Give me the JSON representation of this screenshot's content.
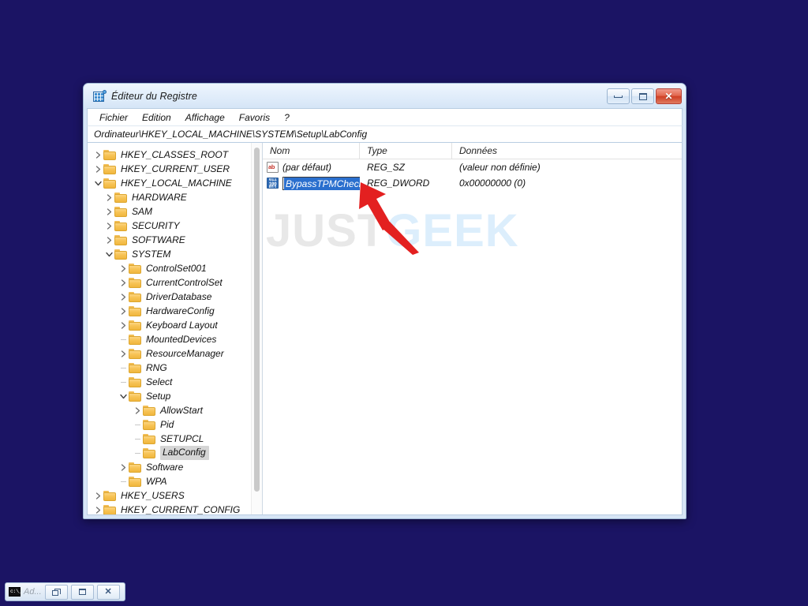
{
  "window": {
    "title": "Éditeur du Registre",
    "title_icon": "registry-editor-icon",
    "controls": {
      "minimize": "minimize-icon",
      "maximize": "restore-icon",
      "close": "close-icon"
    }
  },
  "menubar": {
    "items": [
      {
        "label": "Fichier"
      },
      {
        "label": "Edition"
      },
      {
        "label": "Affichage"
      },
      {
        "label": "Favoris"
      },
      {
        "label": "?"
      }
    ]
  },
  "address": {
    "path": "Ordinateur\\HKEY_LOCAL_MACHINE\\SYSTEM\\Setup\\LabConfig"
  },
  "tree": {
    "nodes": [
      {
        "label": "HKEY_CLASSES_ROOT",
        "depth": 0,
        "state": "collapsed",
        "selected": false
      },
      {
        "label": "HKEY_CURRENT_USER",
        "depth": 0,
        "state": "collapsed",
        "selected": false
      },
      {
        "label": "HKEY_LOCAL_MACHINE",
        "depth": 0,
        "state": "expanded",
        "selected": false
      },
      {
        "label": "HARDWARE",
        "depth": 1,
        "state": "collapsed",
        "selected": false
      },
      {
        "label": "SAM",
        "depth": 1,
        "state": "collapsed",
        "selected": false
      },
      {
        "label": "SECURITY",
        "depth": 1,
        "state": "collapsed",
        "selected": false
      },
      {
        "label": "SOFTWARE",
        "depth": 1,
        "state": "collapsed",
        "selected": false
      },
      {
        "label": "SYSTEM",
        "depth": 1,
        "state": "expanded",
        "selected": false
      },
      {
        "label": "ControlSet001",
        "depth": 2,
        "state": "collapsed",
        "selected": false
      },
      {
        "label": "CurrentControlSet",
        "depth": 2,
        "state": "collapsed",
        "selected": false
      },
      {
        "label": "DriverDatabase",
        "depth": 2,
        "state": "collapsed",
        "selected": false
      },
      {
        "label": "HardwareConfig",
        "depth": 2,
        "state": "collapsed",
        "selected": false
      },
      {
        "label": "Keyboard Layout",
        "depth": 2,
        "state": "collapsed",
        "selected": false
      },
      {
        "label": "MountedDevices",
        "depth": 2,
        "state": "leaf",
        "selected": false
      },
      {
        "label": "ResourceManager",
        "depth": 2,
        "state": "collapsed",
        "selected": false
      },
      {
        "label": "RNG",
        "depth": 2,
        "state": "leaf",
        "selected": false
      },
      {
        "label": "Select",
        "depth": 2,
        "state": "leaf",
        "selected": false
      },
      {
        "label": "Setup",
        "depth": 2,
        "state": "expanded",
        "selected": false
      },
      {
        "label": "AllowStart",
        "depth": 3,
        "state": "collapsed",
        "selected": false
      },
      {
        "label": "Pid",
        "depth": 3,
        "state": "leaf",
        "selected": false
      },
      {
        "label": "SETUPCL",
        "depth": 3,
        "state": "leaf",
        "selected": false
      },
      {
        "label": "LabConfig",
        "depth": 3,
        "state": "leaf",
        "selected": true
      },
      {
        "label": "Software",
        "depth": 2,
        "state": "collapsed",
        "selected": false
      },
      {
        "label": "WPA",
        "depth": 2,
        "state": "leaf",
        "selected": false
      },
      {
        "label": "HKEY_USERS",
        "depth": 0,
        "state": "collapsed",
        "selected": false
      },
      {
        "label": "HKEY_CURRENT_CONFIG",
        "depth": 0,
        "state": "collapsed",
        "selected": false
      }
    ]
  },
  "values": {
    "columns": [
      "Nom",
      "Type",
      "Données"
    ],
    "rows": [
      {
        "icon": "string-value-icon",
        "name": "(par défaut)",
        "type": "REG_SZ",
        "data": "(valeur non définie)",
        "editing": false
      },
      {
        "icon": "dword-value-icon",
        "name": "BypassTPMCheck",
        "type": "REG_DWORD",
        "data": "0x00000000 (0)",
        "editing": true
      }
    ]
  },
  "watermark": {
    "part1": "JUST",
    "part2": "GEEK",
    "color1": "#e8e8e8",
    "color2": "#dceefc"
  },
  "annotation": {
    "arrow": "red-arrow-pointing-to-rename-field",
    "color": "#e32020"
  },
  "taskbar": {
    "app_icon": "command-prompt-icon",
    "app_label": "Ad...",
    "buttons": [
      {
        "name": "restore-window-button",
        "icon": "restore-icon"
      },
      {
        "name": "minimize-window-button",
        "icon": "minimize-icon"
      },
      {
        "name": "close-window-button",
        "icon": "close-icon"
      }
    ]
  },
  "desktop": {
    "background_color": "#1b1464"
  }
}
